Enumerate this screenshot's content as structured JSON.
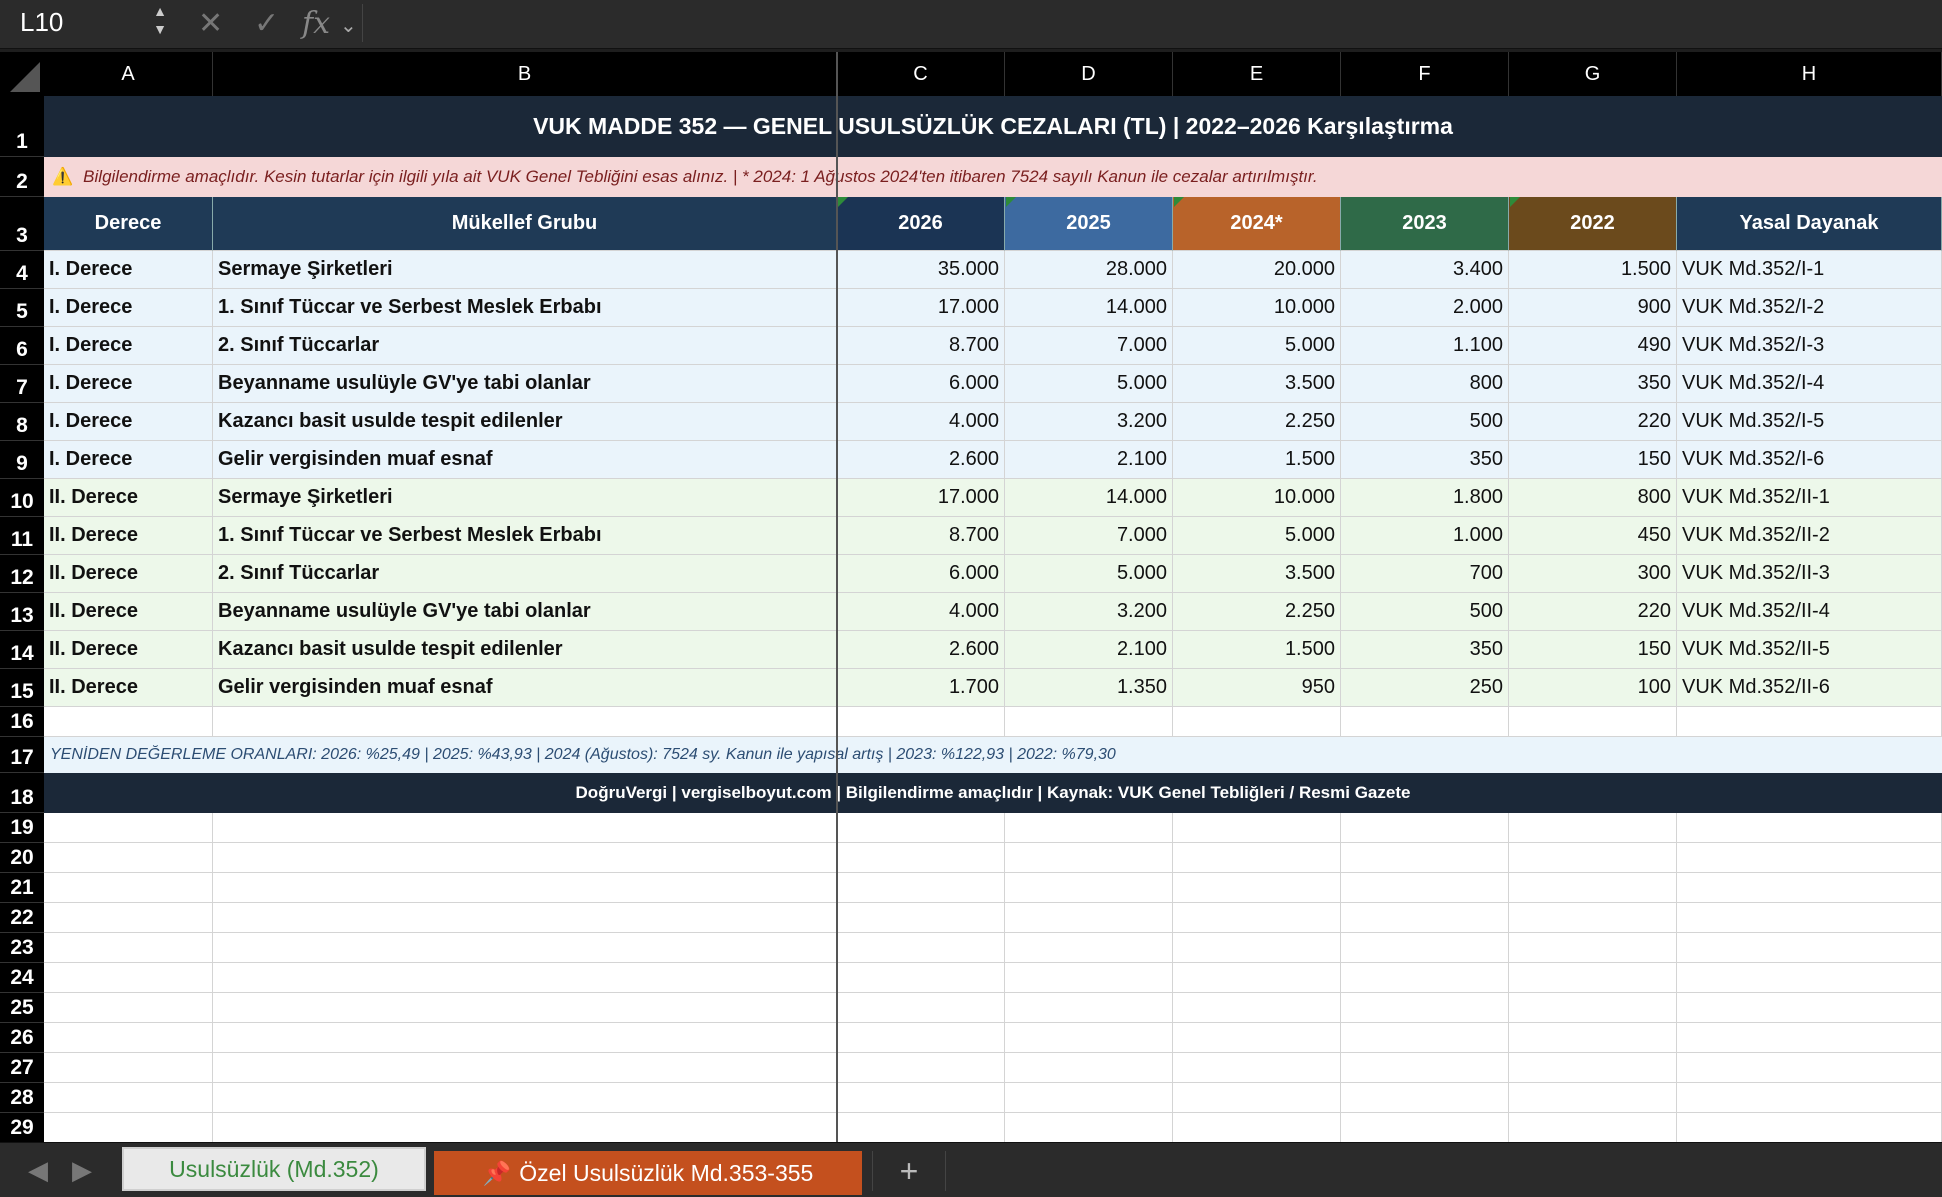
{
  "formula_bar": {
    "name_box": "L10",
    "fx_label": "fx",
    "cancel_icon": "✕",
    "enter_icon": "✓",
    "chevron": "⌄",
    "formula": ""
  },
  "columns": [
    "A",
    "B",
    "C",
    "D",
    "E",
    "F",
    "G",
    "H"
  ],
  "rows": [
    "1",
    "2",
    "3",
    "4",
    "5",
    "6",
    "7",
    "8",
    "9",
    "10",
    "11",
    "12",
    "13",
    "14",
    "15",
    "16",
    "17",
    "18",
    "19",
    "20",
    "21",
    "22",
    "23",
    "24",
    "25",
    "26",
    "27",
    "28",
    "29"
  ],
  "title": "VUK MADDE 352 — GENEL USULSÜZLÜK CEZALARI (TL)  |  2022–2026 Karşılaştırma",
  "note": {
    "icon": "⚠️",
    "text": "Bilgilendirme amaçlıdır. Kesin tutarlar için ilgili yıla ait VUK Genel Tebliğini esas alınız.  |  * 2024: 1 Ağustos 2024'ten itibaren 7524 sayılı Kanun ile cezalar artırılmıştır."
  },
  "headers": {
    "derece": "Derece",
    "grup": "Mükellef Grubu",
    "y2026": "2026",
    "y2025": "2025",
    "y2024": "2024*",
    "y2023": "2023",
    "y2022": "2022",
    "dayanak": "Yasal Dayanak"
  },
  "header_colors": {
    "derece": "#1f3a56",
    "grup": "#1f3a56",
    "y2026": "#1b3454",
    "y2025": "#3d6aa0",
    "y2024": "#b8632a",
    "y2023": "#2f6a48",
    "y2022": "#6b4a1c",
    "dayanak": "#1f3a56"
  },
  "table": [
    {
      "derece": "I. Derece",
      "grup": "Sermaye Şirketleri",
      "y2026": "35.000",
      "y2025": "28.000",
      "y2024": "20.000",
      "y2023": "3.400",
      "y2022": "1.500",
      "dayanak": "VUK Md.352/I-1"
    },
    {
      "derece": "I. Derece",
      "grup": "1. Sınıf Tüccar ve Serbest Meslek Erbabı",
      "y2026": "17.000",
      "y2025": "14.000",
      "y2024": "10.000",
      "y2023": "2.000",
      "y2022": "900",
      "dayanak": "VUK Md.352/I-2"
    },
    {
      "derece": "I. Derece",
      "grup": "2. Sınıf Tüccarlar",
      "y2026": "8.700",
      "y2025": "7.000",
      "y2024": "5.000",
      "y2023": "1.100",
      "y2022": "490",
      "dayanak": "VUK Md.352/I-3"
    },
    {
      "derece": "I. Derece",
      "grup": "Beyanname usulüyle GV'ye tabi olanlar",
      "y2026": "6.000",
      "y2025": "5.000",
      "y2024": "3.500",
      "y2023": "800",
      "y2022": "350",
      "dayanak": "VUK Md.352/I-4"
    },
    {
      "derece": "I. Derece",
      "grup": "Kazancı basit usulde tespit edilenler",
      "y2026": "4.000",
      "y2025": "3.200",
      "y2024": "2.250",
      "y2023": "500",
      "y2022": "220",
      "dayanak": "VUK Md.352/I-5"
    },
    {
      "derece": "I. Derece",
      "grup": "Gelir vergisinden muaf esnaf",
      "y2026": "2.600",
      "y2025": "2.100",
      "y2024": "1.500",
      "y2023": "350",
      "y2022": "150",
      "dayanak": "VUK Md.352/I-6"
    },
    {
      "derece": "II. Derece",
      "grup": "Sermaye Şirketleri",
      "y2026": "17.000",
      "y2025": "14.000",
      "y2024": "10.000",
      "y2023": "1.800",
      "y2022": "800",
      "dayanak": "VUK Md.352/II-1"
    },
    {
      "derece": "II. Derece",
      "grup": "1. Sınıf Tüccar ve Serbest Meslek Erbabı",
      "y2026": "8.700",
      "y2025": "7.000",
      "y2024": "5.000",
      "y2023": "1.000",
      "y2022": "450",
      "dayanak": "VUK Md.352/II-2"
    },
    {
      "derece": "II. Derece",
      "grup": "2. Sınıf Tüccarlar",
      "y2026": "6.000",
      "y2025": "5.000",
      "y2024": "3.500",
      "y2023": "700",
      "y2022": "300",
      "dayanak": "VUK Md.352/II-3"
    },
    {
      "derece": "II. Derece",
      "grup": "Beyanname usulüyle GV'ye tabi olanlar",
      "y2026": "4.000",
      "y2025": "3.200",
      "y2024": "2.250",
      "y2023": "500",
      "y2022": "220",
      "dayanak": "VUK Md.352/II-4"
    },
    {
      "derece": "II. Derece",
      "grup": "Kazancı basit usulde tespit edilenler",
      "y2026": "2.600",
      "y2025": "2.100",
      "y2024": "1.500",
      "y2023": "350",
      "y2022": "150",
      "dayanak": "VUK Md.352/II-5"
    },
    {
      "derece": "II. Derece",
      "grup": "Gelir vergisinden muaf esnaf",
      "y2026": "1.700",
      "y2025": "1.350",
      "y2024": "950",
      "y2023": "250",
      "y2022": "100",
      "dayanak": "VUK Md.352/II-6"
    }
  ],
  "row_fill": {
    "I. Derece": "#eaf4fb",
    "II. Derece": "#edf8ea"
  },
  "rates": "YENİDEN DEĞERLEME ORANLARI:  2026: %25,49  |  2025: %43,93  |  2024 (Ağustos): 7524 sy. Kanun ile yapısal artış  |  2023: %122,93  |  2022: %79,30",
  "footer": "DoğruVergi  |  vergiselboyut.com  |  Bilgilendirme amaçlıdır  |  Kaynak: VUK Genel Tebliğleri / Resmi Gazete",
  "tabs": {
    "nav_prev": "◀",
    "nav_next": "▶",
    "sheet1": "Usulsüzlük (Md.352)",
    "sheet2_icon": "📌",
    "sheet2": "Özel Usulsüzlük Md.353-355",
    "add": "+"
  }
}
